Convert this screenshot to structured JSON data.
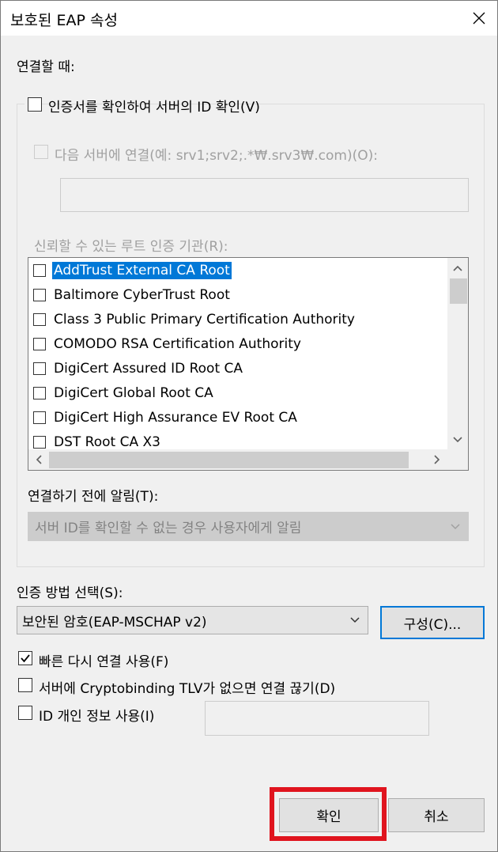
{
  "window": {
    "title": "보호된 EAP 속성"
  },
  "connect_label": "연결할 때:",
  "verify_cert": {
    "label": "인증서를 확인하여 서버의 ID 확인(V)",
    "checked": false
  },
  "connect_servers": {
    "label": "다음 서버에 연결(예: srv1;srv2;.*₩.srv3₩.com)(O):",
    "checked": false,
    "value": ""
  },
  "trusted_ca_label": "신뢰할 수 있는 루트 인증 기관(R):",
  "ca_list": [
    {
      "name": "AddTrust External CA Root",
      "checked": false,
      "selected": true
    },
    {
      "name": "Baltimore CyberTrust Root",
      "checked": false,
      "selected": false
    },
    {
      "name": "Class 3 Public Primary Certification Authority",
      "checked": false,
      "selected": false
    },
    {
      "name": "COMODO RSA Certification Authority",
      "checked": false,
      "selected": false
    },
    {
      "name": "DigiCert Assured ID Root CA",
      "checked": false,
      "selected": false
    },
    {
      "name": "DigiCert Global Root CA",
      "checked": false,
      "selected": false
    },
    {
      "name": "DigiCert High Assurance EV Root CA",
      "checked": false,
      "selected": false
    },
    {
      "name": "DST Root CA X3",
      "checked": false,
      "selected": false
    }
  ],
  "notify_label": "연결하기 전에 알림(T):",
  "notify_value": "서버 ID를 확인할 수 없는 경우 사용자에게 알림",
  "auth_method_label": "인증 방법 선택(S):",
  "auth_method_value": "보안된 암호(EAP-MSCHAP v2)",
  "configure_button": "구성(C)...",
  "fast_reconnect": {
    "label": "빠른 다시 연결 사용(F)",
    "checked": true
  },
  "cryptobinding": {
    "label": "서버에 Cryptobinding TLV가 없으면 연결 끊기(D)",
    "checked": false
  },
  "identity_privacy": {
    "label": "ID 개인 정보 사용(I)",
    "checked": false,
    "value": ""
  },
  "ok_button": "확인",
  "cancel_button": "취소",
  "colors": {
    "highlight": "#e0141e",
    "selection": "#0078d7",
    "face": "#f0f0f0"
  }
}
